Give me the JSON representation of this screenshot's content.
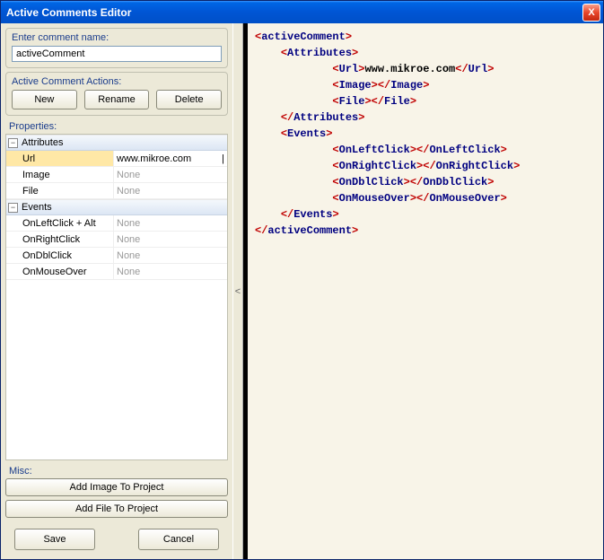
{
  "window": {
    "title": "Active Comments Editor",
    "close": "X"
  },
  "nameSection": {
    "label": "Enter comment name:",
    "value": "activeComment"
  },
  "actions": {
    "label": "Active Comment Actions:",
    "new": "New",
    "rename": "Rename",
    "delete": "Delete"
  },
  "propsLabel": "Properties:",
  "props": {
    "groups": [
      {
        "name": "Attributes",
        "rows": [
          {
            "name": "Url",
            "value": "www.mikroe.com",
            "selected": true,
            "editing": true
          },
          {
            "name": "Image",
            "value": "None"
          },
          {
            "name": "File",
            "value": "None"
          }
        ]
      },
      {
        "name": "Events",
        "rows": [
          {
            "name": "OnLeftClick + Alt",
            "value": "None"
          },
          {
            "name": "OnRightClick",
            "value": "None"
          },
          {
            "name": "OnDblClick",
            "value": "None"
          },
          {
            "name": "OnMouseOver",
            "value": "None"
          }
        ]
      }
    ]
  },
  "misc": {
    "label": "Misc:",
    "addImage": "Add Image To Project",
    "addFile": "Add File  To Project"
  },
  "bottom": {
    "save": "Save",
    "cancel": "Cancel"
  },
  "splitter": "<",
  "xml": {
    "root": "activeComment",
    "attributes": "Attributes",
    "events": "Events",
    "url": {
      "tag": "Url",
      "val": "www.mikroe.com"
    },
    "image": {
      "tag": "Image"
    },
    "file": {
      "tag": "File"
    },
    "onLeft": "OnLeftClick",
    "onRight": "OnRightClick",
    "onDbl": "OnDblClick",
    "onMouse": "OnMouseOver"
  }
}
